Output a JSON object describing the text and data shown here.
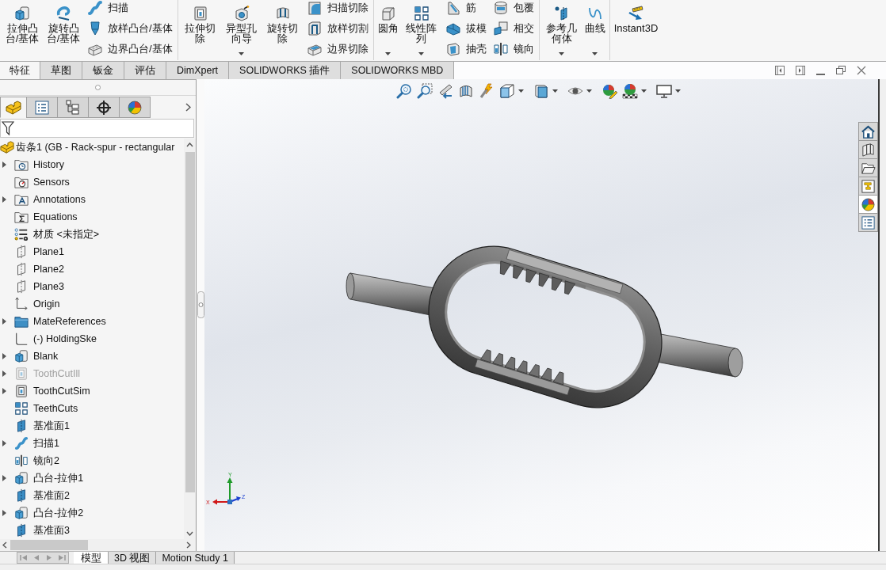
{
  "ribbon": {
    "groups": [
      {
        "buttons": [
          {
            "label": "拉伸凸台/基体",
            "dropdown": false
          },
          {
            "label": "旋转凸台/基体",
            "dropdown": false
          }
        ],
        "columns": [
          [
            "扫描",
            "放样凸台/基体",
            "边界凸台/基体"
          ]
        ]
      },
      {
        "buttons": [
          {
            "label": "拉伸切除",
            "dropdown": false
          },
          {
            "label": "异型孔向导",
            "dropdown": true
          },
          {
            "label": "旋转切除",
            "dropdown": false
          }
        ],
        "columns": [
          [
            "扫描切除",
            "放样切割",
            "边界切除"
          ]
        ]
      },
      {
        "buttons": [
          {
            "label": "圆角",
            "dropdown": true
          },
          {
            "label": "线性阵列",
            "dropdown": true
          }
        ],
        "columns": [
          [
            "筋",
            "拔模",
            "抽壳"
          ],
          [
            "包覆",
            "相交",
            "镜向"
          ]
        ]
      },
      {
        "buttons": [
          {
            "label": "参考几何体",
            "dropdown": true
          },
          {
            "label": "曲线",
            "dropdown": true
          }
        ]
      },
      {
        "buttons": [
          {
            "label": "Instant3D",
            "dropdown": false
          }
        ]
      }
    ]
  },
  "ribbon_tabs": [
    {
      "label": "特征",
      "selected": true
    },
    {
      "label": "草图",
      "selected": false
    },
    {
      "label": "钣金",
      "selected": false
    },
    {
      "label": "评估",
      "selected": false
    },
    {
      "label": "DimXpert",
      "selected": false
    },
    {
      "label": "SOLIDWORKS 插件",
      "selected": false
    },
    {
      "label": "SOLIDWORKS MBD",
      "selected": false
    }
  ],
  "feature_manager": {
    "tabs": [
      {
        "selected": true
      },
      {
        "selected": false
      },
      {
        "selected": false
      },
      {
        "selected": false
      },
      {
        "selected": false
      }
    ],
    "tree": [
      {
        "label": "齿条1 (GB - Rack-spur - rectangular",
        "kind": "part",
        "expandable": false,
        "disabled": false,
        "children": [
          {
            "label": "History",
            "kind": "history",
            "expandable": true,
            "disabled": false
          },
          {
            "label": "Sensors",
            "kind": "sensors",
            "expandable": false,
            "disabled": false
          },
          {
            "label": "Annotations",
            "kind": "annotations",
            "expandable": true,
            "disabled": false
          },
          {
            "label": "Equations",
            "kind": "equations",
            "expandable": false,
            "disabled": false
          },
          {
            "label": "材质 <未指定>",
            "kind": "material",
            "expandable": false,
            "disabled": false
          },
          {
            "label": "Plane1",
            "kind": "plane",
            "expandable": false,
            "disabled": false
          },
          {
            "label": "Plane2",
            "kind": "plane",
            "expandable": false,
            "disabled": false
          },
          {
            "label": "Plane3",
            "kind": "plane",
            "expandable": false,
            "disabled": false
          },
          {
            "label": "Origin",
            "kind": "origin",
            "expandable": false,
            "disabled": false
          },
          {
            "label": "MateReferences",
            "kind": "folder",
            "expandable": true,
            "disabled": false
          },
          {
            "label": "(-) HoldingSke",
            "kind": "sketch",
            "expandable": false,
            "disabled": false
          },
          {
            "label": "Blank",
            "kind": "extrude",
            "expandable": true,
            "disabled": false
          },
          {
            "label": "ToothCutIll",
            "kind": "cut",
            "expandable": true,
            "disabled": true
          },
          {
            "label": "ToothCutSim",
            "kind": "cut",
            "expandable": true,
            "disabled": false
          },
          {
            "label": "TeethCuts",
            "kind": "pattern",
            "expandable": false,
            "disabled": false
          },
          {
            "label": "基准面1",
            "kind": "refplane",
            "expandable": false,
            "disabled": false
          },
          {
            "label": "扫描1",
            "kind": "sweep",
            "expandable": true,
            "disabled": false
          },
          {
            "label": "镜向2",
            "kind": "mirror",
            "expandable": false,
            "disabled": false
          },
          {
            "label": "凸台-拉伸1",
            "kind": "extrude",
            "expandable": true,
            "disabled": false
          },
          {
            "label": "基准面2",
            "kind": "refplane",
            "expandable": false,
            "disabled": false
          },
          {
            "label": "凸台-拉伸2",
            "kind": "extrude",
            "expandable": true,
            "disabled": false
          },
          {
            "label": "基准面3",
            "kind": "refplane",
            "expandable": false,
            "disabled": false
          }
        ]
      }
    ]
  },
  "task_pane_tabs": [
    {
      "selected": false
    },
    {
      "selected": false
    },
    {
      "selected": false
    },
    {
      "selected": false
    },
    {
      "selected": true
    },
    {
      "selected": false
    }
  ],
  "triad": {
    "x_label": "X",
    "y_label": "Y",
    "z_label": "Z"
  },
  "bottom_tabs": [
    {
      "label": "模型",
      "selected": true
    },
    {
      "label": "3D 视图",
      "selected": false
    },
    {
      "label": "Motion Study 1",
      "selected": false
    }
  ]
}
